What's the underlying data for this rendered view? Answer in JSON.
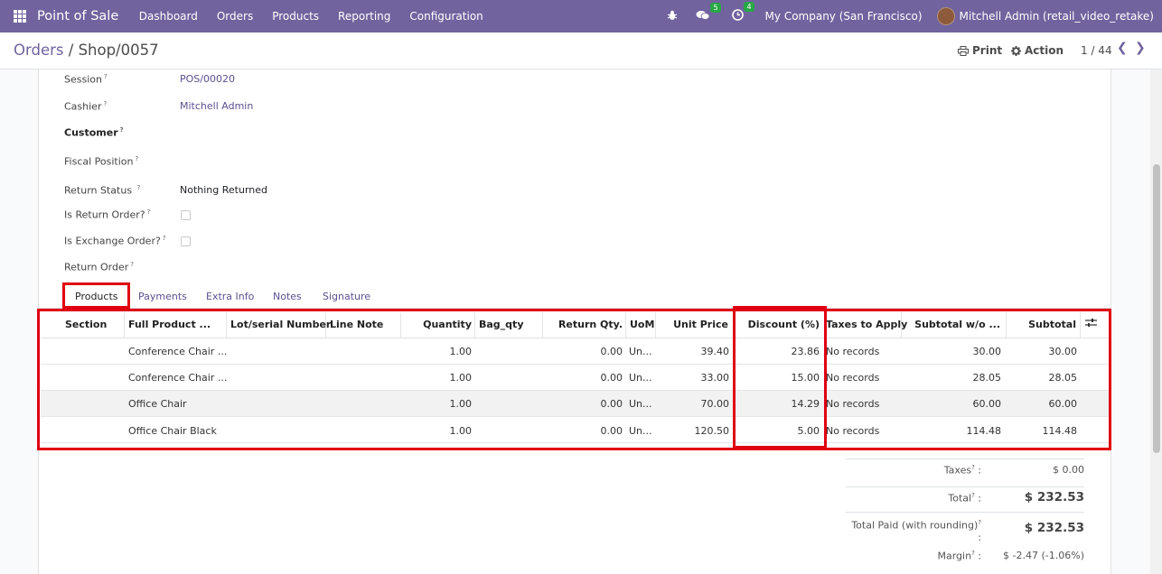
{
  "navbar": {
    "app_name": "Point of Sale",
    "menu": [
      "Dashboard",
      "Orders",
      "Products",
      "Reporting",
      "Configuration"
    ],
    "messages_count": "5",
    "activities_count": "4",
    "company": "My Company (San Francisco)",
    "user": "Mitchell Admin (retail_video_retake)",
    "color": "#71639e"
  },
  "control_panel": {
    "breadcrumb_parent": "Orders",
    "breadcrumb_sep": "/",
    "breadcrumb_current": "Shop/0057",
    "print_label": "Print",
    "action_label": "Action",
    "pager": "1 / 44"
  },
  "form": {
    "session_label": "Session",
    "session_value": "POS/00020",
    "cashier_label": "Cashier",
    "cashier_value": "Mitchell Admin",
    "customer_label": "Customer",
    "fiscal_position_label": "Fiscal Position",
    "return_status_label": "Return Status",
    "return_status_value": "Nothing Returned",
    "is_return_label": "Is Return Order?",
    "is_exchange_label": "Is Exchange Order?",
    "return_order_label": "Return Order",
    "help_mark": "?"
  },
  "tabs": [
    "Products",
    "Payments",
    "Extra Info",
    "Notes",
    "Signature"
  ],
  "table": {
    "headers": [
      "Section",
      "Full Product ...",
      "Lot/serial Number",
      "Line Note",
      "Quantity",
      "Bag_qty",
      "Return Qty.",
      "UoM",
      "Unit Price",
      "Discount (%)",
      "Taxes to Apply",
      "Subtotal w/o ...",
      "Subtotal"
    ],
    "rows": [
      {
        "product": "Conference Chair ...",
        "quantity": "1.00",
        "return_qty": "0.00",
        "uom": "Un...",
        "unit_price": "39.40",
        "discount": "23.86",
        "taxes": "No records",
        "subtotal_wo": "30.00",
        "subtotal": "30.00"
      },
      {
        "product": "Conference Chair ...",
        "quantity": "1.00",
        "return_qty": "0.00",
        "uom": "Un...",
        "unit_price": "33.00",
        "discount": "15.00",
        "taxes": "No records",
        "subtotal_wo": "28.05",
        "subtotal": "28.05"
      },
      {
        "product": "Office Chair",
        "quantity": "1.00",
        "return_qty": "0.00",
        "uom": "Un...",
        "unit_price": "70.00",
        "discount": "14.29",
        "taxes": "No records",
        "subtotal_wo": "60.00",
        "subtotal": "60.00"
      },
      {
        "product": "Office Chair Black",
        "quantity": "1.00",
        "return_qty": "0.00",
        "uom": "Un...",
        "unit_price": "120.50",
        "discount": "5.00",
        "taxes": "No records",
        "subtotal_wo": "114.48",
        "subtotal": "114.48"
      }
    ]
  },
  "totals": {
    "taxes_label": "Taxes",
    "taxes_value": "$ 0.00",
    "total_label": "Total",
    "total_value": "$ 232.53",
    "paid_label": "Total Paid (with rounding)",
    "paid_value": "$ 232.53",
    "margin_label": "Margin",
    "margin_value": "$ -2.47 (-1.06%)"
  },
  "annotation_color": "#e0000f"
}
